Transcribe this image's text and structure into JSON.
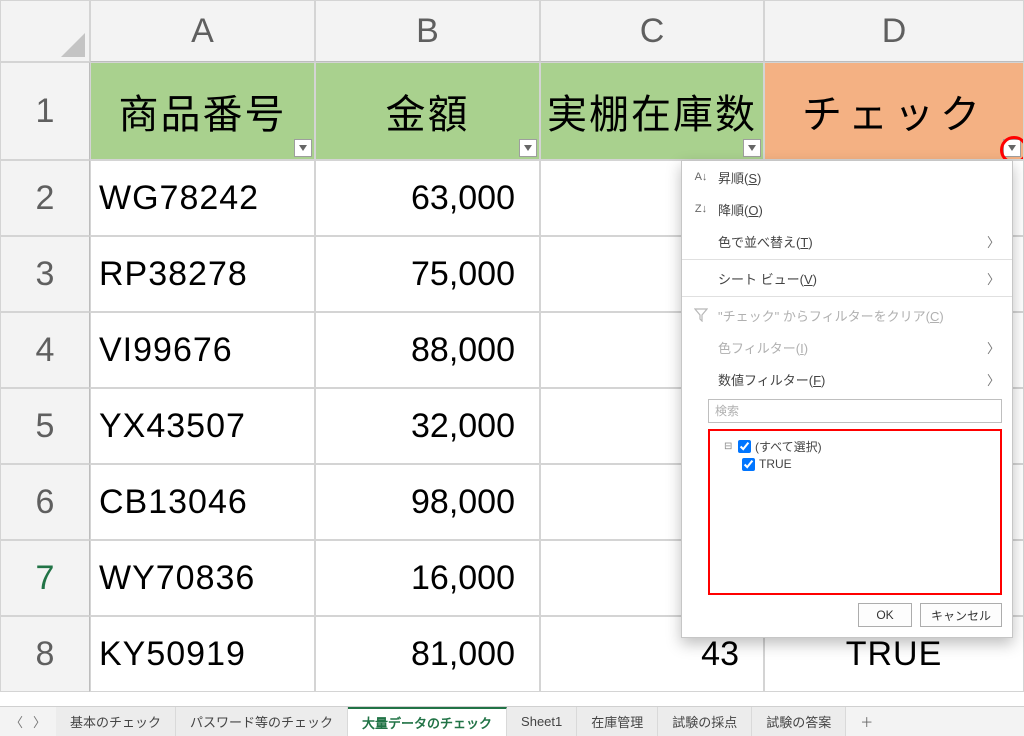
{
  "columns": [
    "A",
    "B",
    "C",
    "D"
  ],
  "rows": [
    "1",
    "2",
    "3",
    "4",
    "5",
    "6",
    "7",
    "8"
  ],
  "selected_row_index": 6,
  "headers": {
    "A": "商品番号",
    "B": "金額",
    "C": "実棚在庫数",
    "D": "チェック"
  },
  "data": [
    {
      "a": "WG78242",
      "b": "63,000",
      "c": "",
      "d": ""
    },
    {
      "a": "RP38278",
      "b": "75,000",
      "c": "",
      "d": ""
    },
    {
      "a": "VI99676",
      "b": "88,000",
      "c": "",
      "d": ""
    },
    {
      "a": "YX43507",
      "b": "32,000",
      "c": "",
      "d": ""
    },
    {
      "a": "CB13046",
      "b": "98,000",
      "c": "",
      "d": ""
    },
    {
      "a": "WY70836",
      "b": "16,000",
      "c": "",
      "d": ""
    },
    {
      "a": "KY50919",
      "b": "81,000",
      "c": "43",
      "d": "TRUE"
    }
  ],
  "menu": {
    "sort_asc": "昇順",
    "sort_asc_key": "S",
    "sort_desc": "降順",
    "sort_desc_key": "O",
    "sort_by_color": "色で並べ替え",
    "sort_by_color_key": "T",
    "sheet_view": "シート ビュー",
    "sheet_view_key": "V",
    "clear_filter": "\"チェック\" からフィルターをクリア",
    "clear_filter_key": "C",
    "color_filter": "色フィルター",
    "color_filter_key": "I",
    "number_filter": "数値フィルター",
    "number_filter_key": "F",
    "search_placeholder": "検索",
    "select_all": "(すべて選択)",
    "option_true": "TRUE",
    "ok": "OK",
    "cancel": "キャンセル"
  },
  "tabs": {
    "t1": "基本のチェック",
    "t2": "パスワード等のチェック",
    "t3": "大量データのチェック",
    "t4": "Sheet1",
    "t5": "在庫管理",
    "t6": "試験の採点",
    "t7": "試験の答案",
    "add": "＋"
  }
}
